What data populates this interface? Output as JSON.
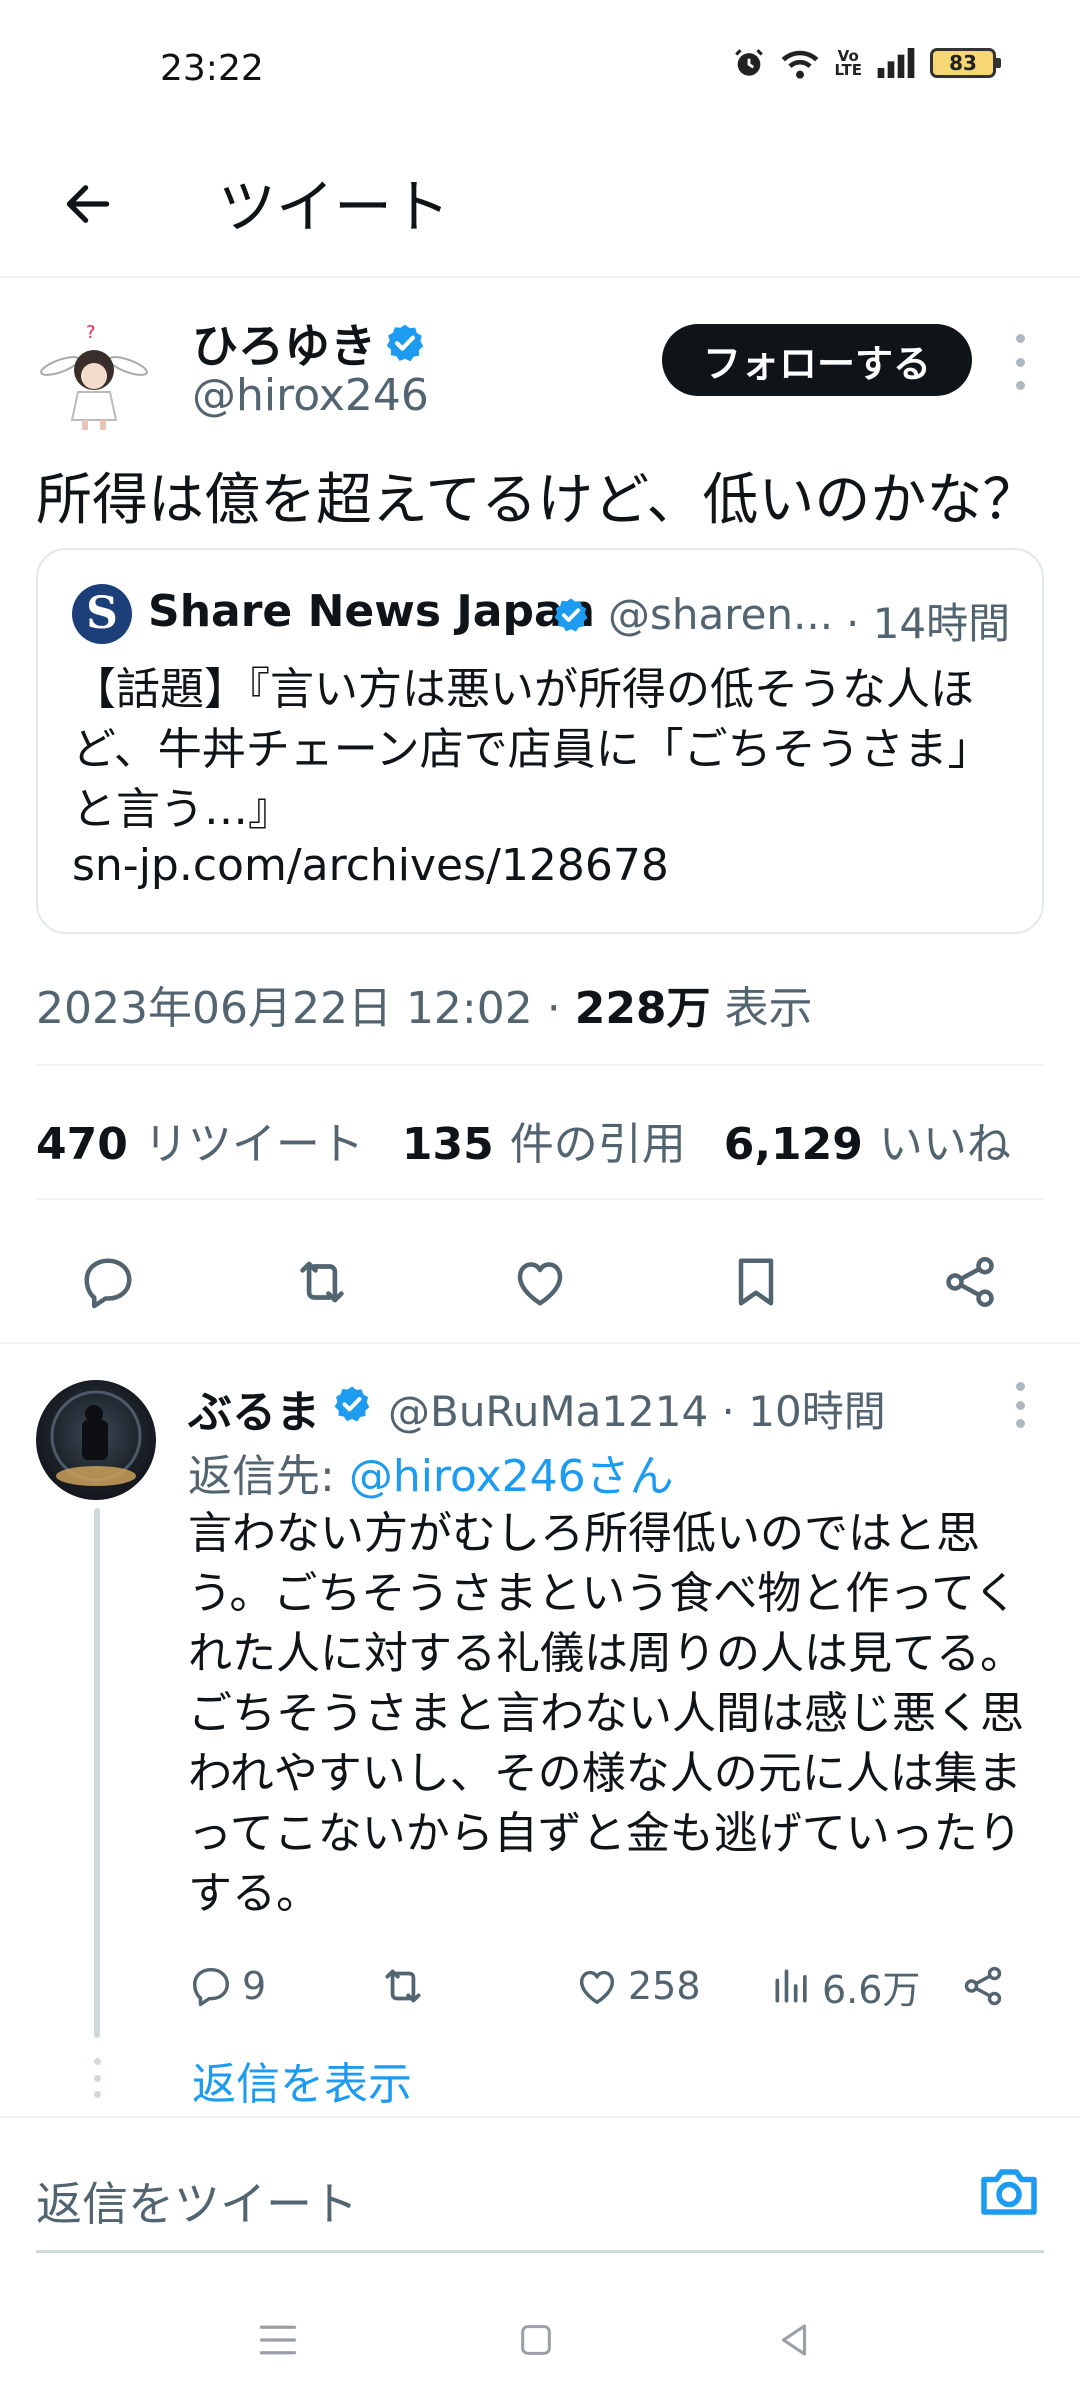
{
  "status_bar": {
    "time": "23:22",
    "battery": "83"
  },
  "header": {
    "title": "ツイート"
  },
  "tweet": {
    "author_name": "ひろゆき",
    "author_handle": "@hirox246",
    "follow_label": "フォローする",
    "text": "所得は億を超えてるけど、低いのかな？",
    "quote": {
      "avatar_letter": "S",
      "name": "Share News Japan",
      "handle": "@sharen...",
      "time": "· 14時間",
      "body": "【話題】『言い方は悪いが所得の低そうな人ほど、牛丼チェーン店で店員に「ごちそうさま」と言う…』",
      "link": "sn-jp.com/archives/128678"
    },
    "datetime": "2023年06月22日 12:02 · ",
    "views_count": "228万",
    "views_label": "表示",
    "retweets_count": "470",
    "retweets_label": "リツイート",
    "quotes_count": "135",
    "quotes_label": "件の引用",
    "likes_count": "6,129",
    "likes_label": "いいね"
  },
  "reply": {
    "author_name": "ぶるま",
    "handle_time": "@BuRuMa1214 · 10時間",
    "reply_to_prefix": "返信先: ",
    "reply_to_handle": "@hirox246さん",
    "body": "言わない方がむしろ所得低いのではと思う。ごちそうさまという食べ物と作ってくれた人に対する礼儀は周りの人は見てる。ごちそうさまと言わない人間は感じ悪く思われやすいし、その様な人の元に人は集まってこないから自ずと金も逃げていったりする。",
    "reply_count": "9",
    "like_count": "258",
    "view_count": "6.6万",
    "show_replies": "返信を表示"
  },
  "compose": {
    "placeholder": "返信をツイート"
  },
  "colors": {
    "accent": "#1d9bf0",
    "text": "#0f1419",
    "muted": "#536471"
  },
  "icons": [
    "back-arrow-icon",
    "verified-badge-icon",
    "more-vert-icon",
    "reply-icon",
    "retweet-icon",
    "like-icon",
    "bookmark-icon",
    "share-icon",
    "views-icon",
    "camera-icon",
    "menu-icon",
    "home-icon",
    "back-icon"
  ]
}
